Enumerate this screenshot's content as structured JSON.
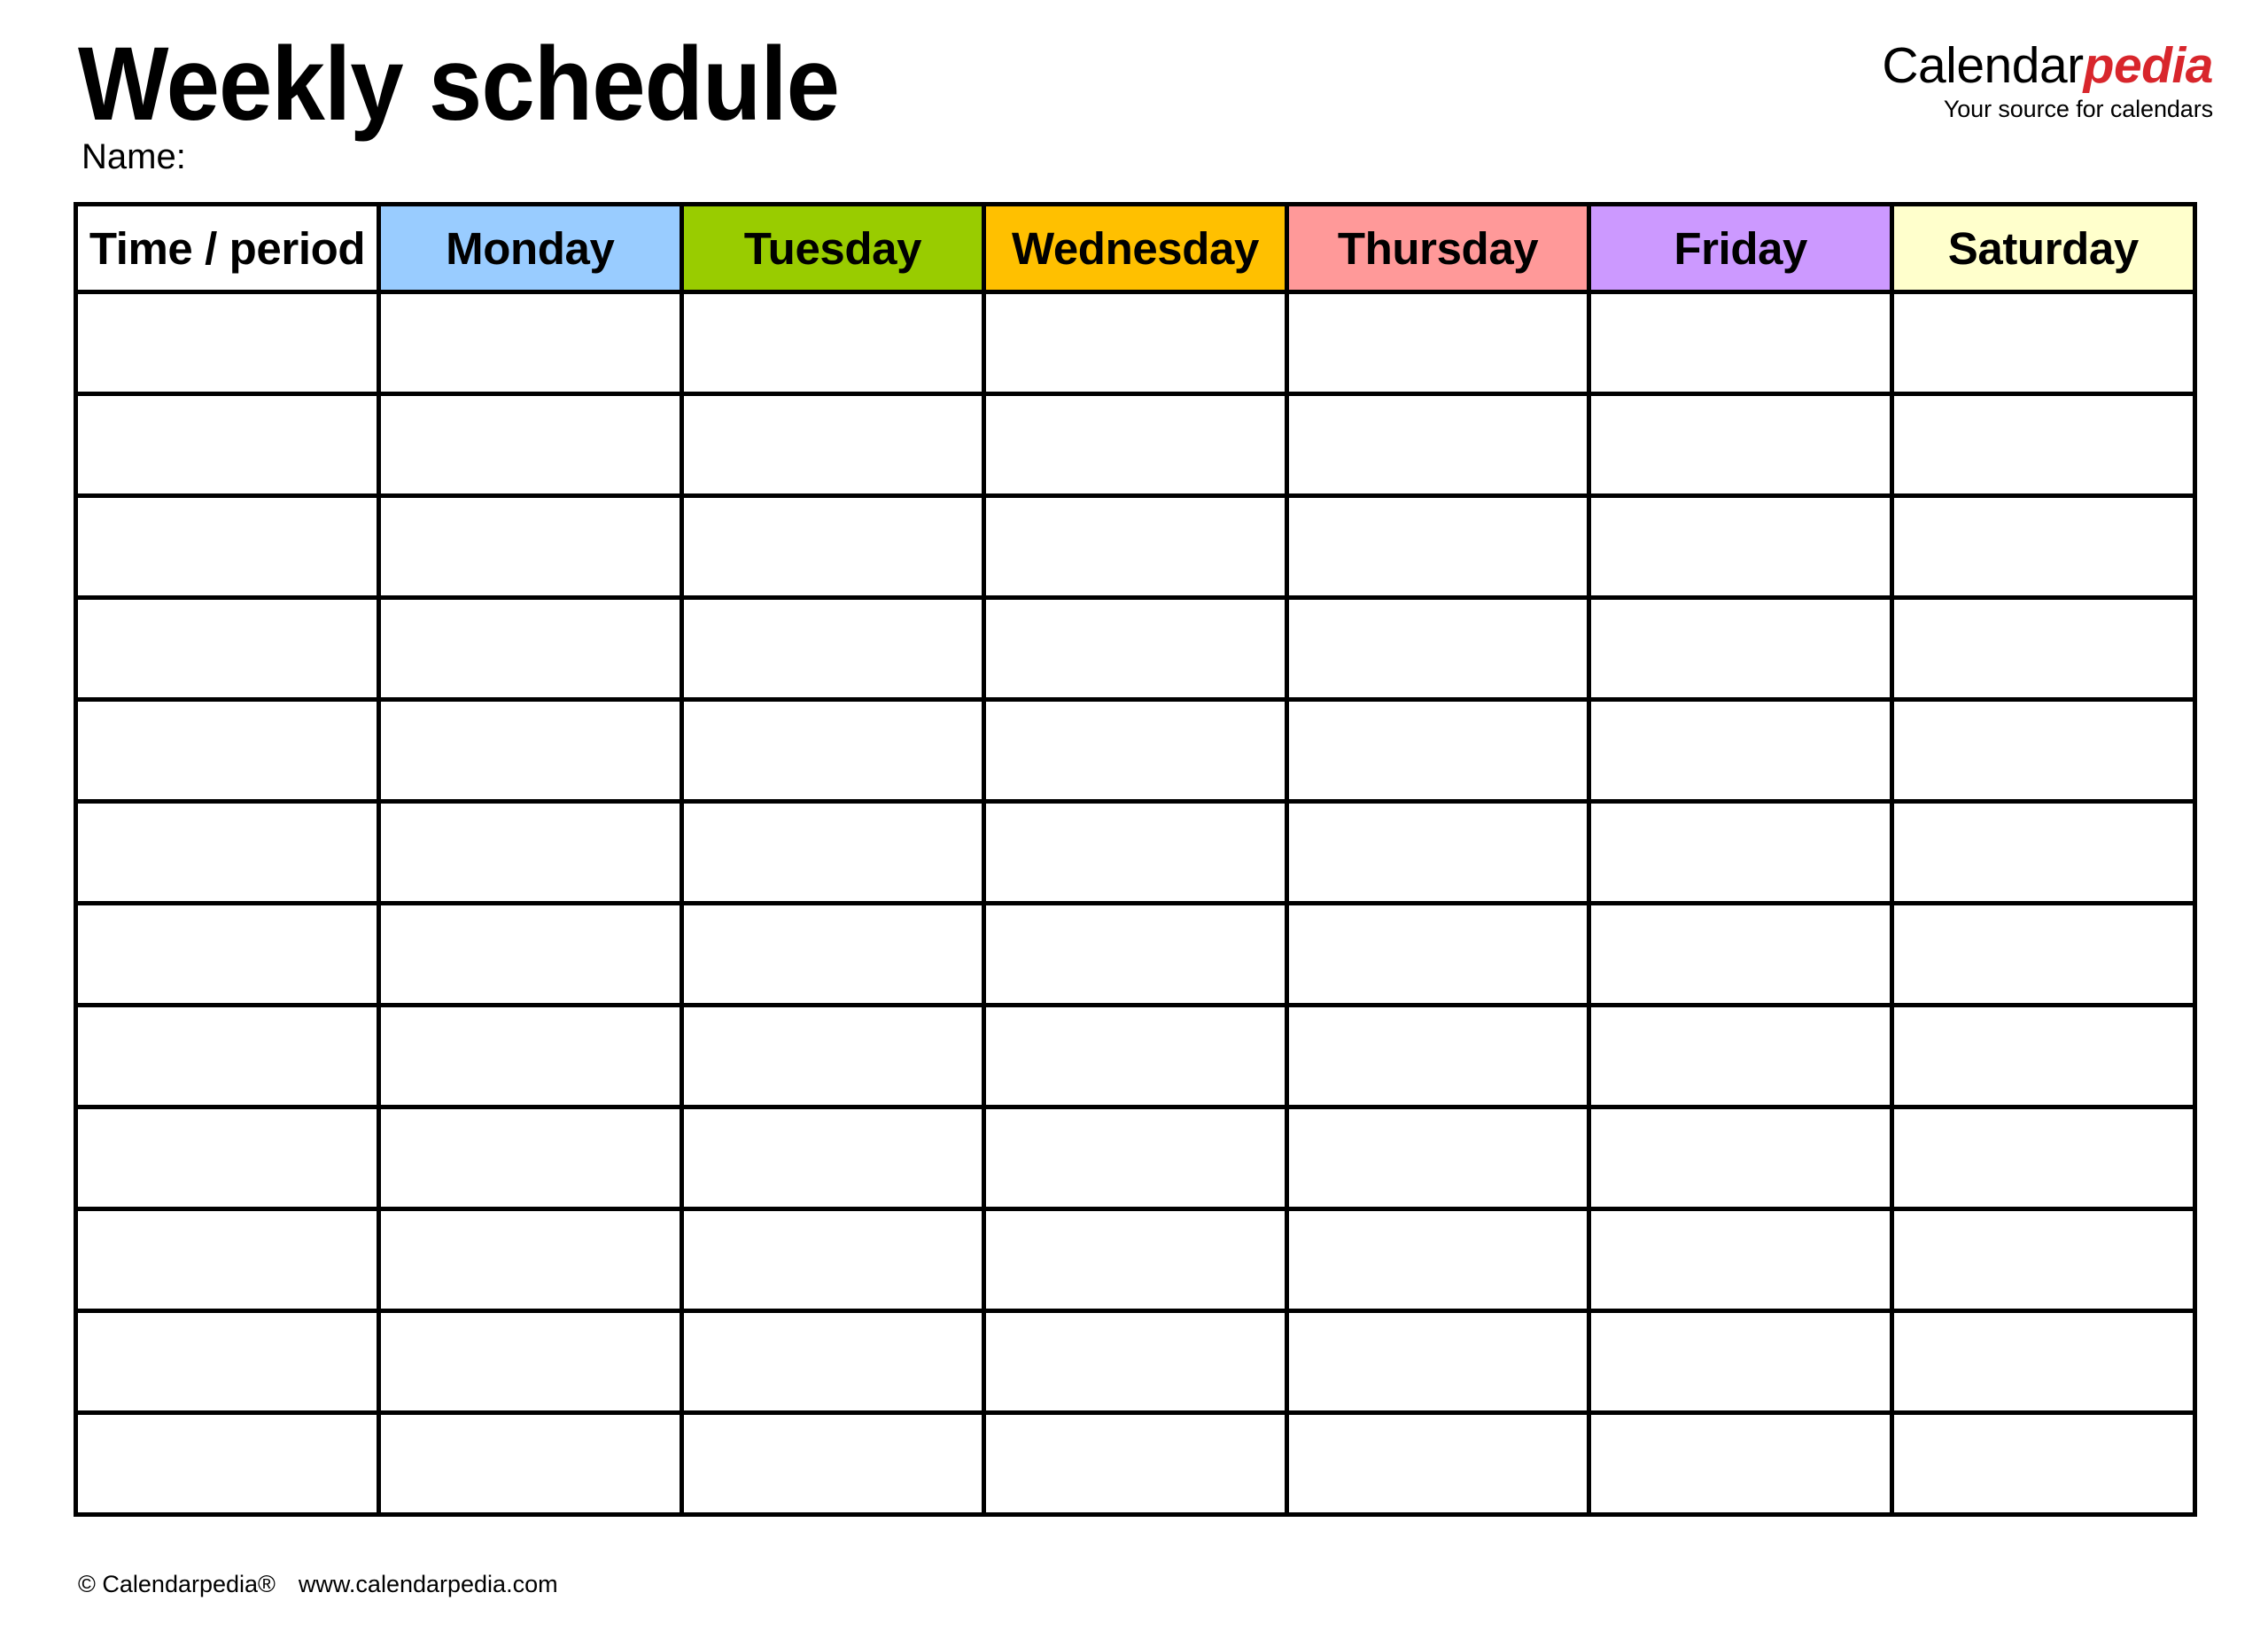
{
  "document": {
    "title": "Weekly schedule",
    "name_label": "Name:"
  },
  "brand": {
    "part1": "Calendar",
    "part2": "pedia",
    "tagline": "Your source for calendars",
    "accent_color": "#D8262C"
  },
  "table": {
    "columns": [
      {
        "label": "Time / period",
        "color": "#FFFFFF"
      },
      {
        "label": "Monday",
        "color": "#99CCFF"
      },
      {
        "label": "Tuesday",
        "color": "#99CC00"
      },
      {
        "label": "Wednesday",
        "color": "#FFC000"
      },
      {
        "label": "Thursday",
        "color": "#FF9999"
      },
      {
        "label": "Friday",
        "color": "#CC99FF"
      },
      {
        "label": "Saturday",
        "color": "#FFFFCC"
      }
    ],
    "row_count": 12,
    "rows": [
      [
        "",
        "",
        "",
        "",
        "",
        "",
        ""
      ],
      [
        "",
        "",
        "",
        "",
        "",
        "",
        ""
      ],
      [
        "",
        "",
        "",
        "",
        "",
        "",
        ""
      ],
      [
        "",
        "",
        "",
        "",
        "",
        "",
        ""
      ],
      [
        "",
        "",
        "",
        "",
        "",
        "",
        ""
      ],
      [
        "",
        "",
        "",
        "",
        "",
        "",
        ""
      ],
      [
        "",
        "",
        "",
        "",
        "",
        "",
        ""
      ],
      [
        "",
        "",
        "",
        "",
        "",
        "",
        ""
      ],
      [
        "",
        "",
        "",
        "",
        "",
        "",
        ""
      ],
      [
        "",
        "",
        "",
        "",
        "",
        "",
        ""
      ],
      [
        "",
        "",
        "",
        "",
        "",
        "",
        ""
      ],
      [
        "",
        "",
        "",
        "",
        "",
        "",
        ""
      ]
    ],
    "border_color": "#000000"
  },
  "footer": {
    "copyright": "© Calendarpedia®",
    "website": "www.calendarpedia.com"
  }
}
